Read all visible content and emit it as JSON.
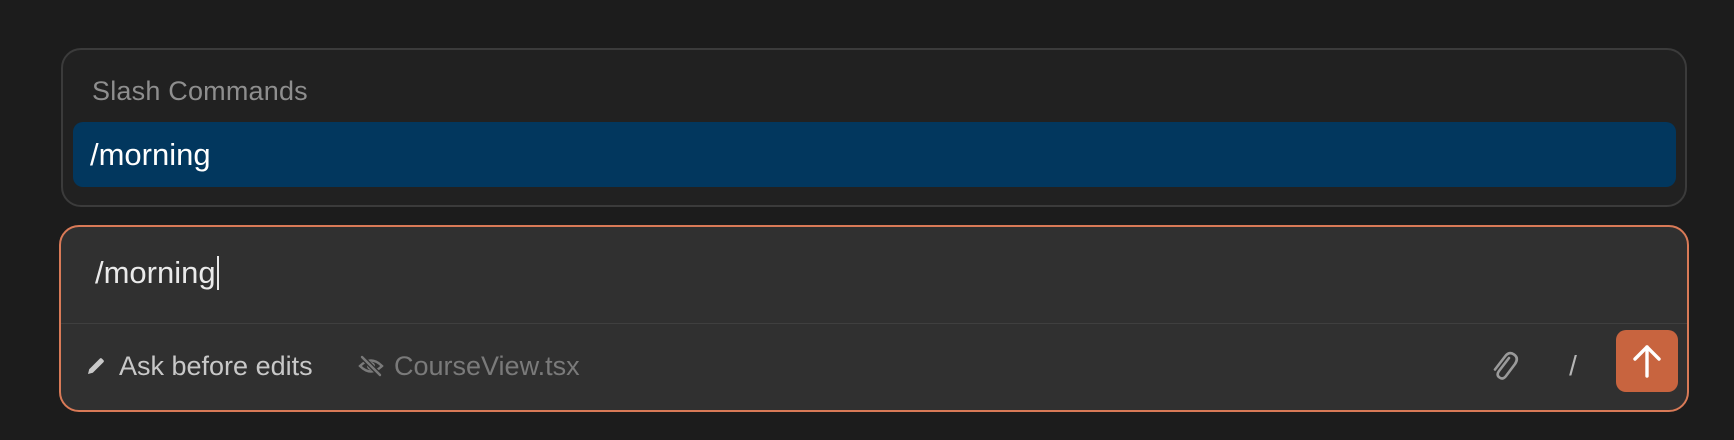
{
  "slash_menu": {
    "title": "Slash Commands",
    "items": [
      {
        "label": "/morning",
        "selected": true
      }
    ]
  },
  "composer": {
    "input_value": "/morning",
    "mode_label": "Ask before edits",
    "mode_icon": "pencil-icon",
    "file_label": "CourseView.tsx",
    "file_icon": "eye-slash-icon",
    "attach_icon": "paperclip-icon",
    "slash_label": "/",
    "send_icon": "arrow-up-icon"
  },
  "colors": {
    "accent": "#d97a57",
    "send_button": "#c8643f",
    "selection": "#02375e",
    "background": "#1c1c1c"
  }
}
